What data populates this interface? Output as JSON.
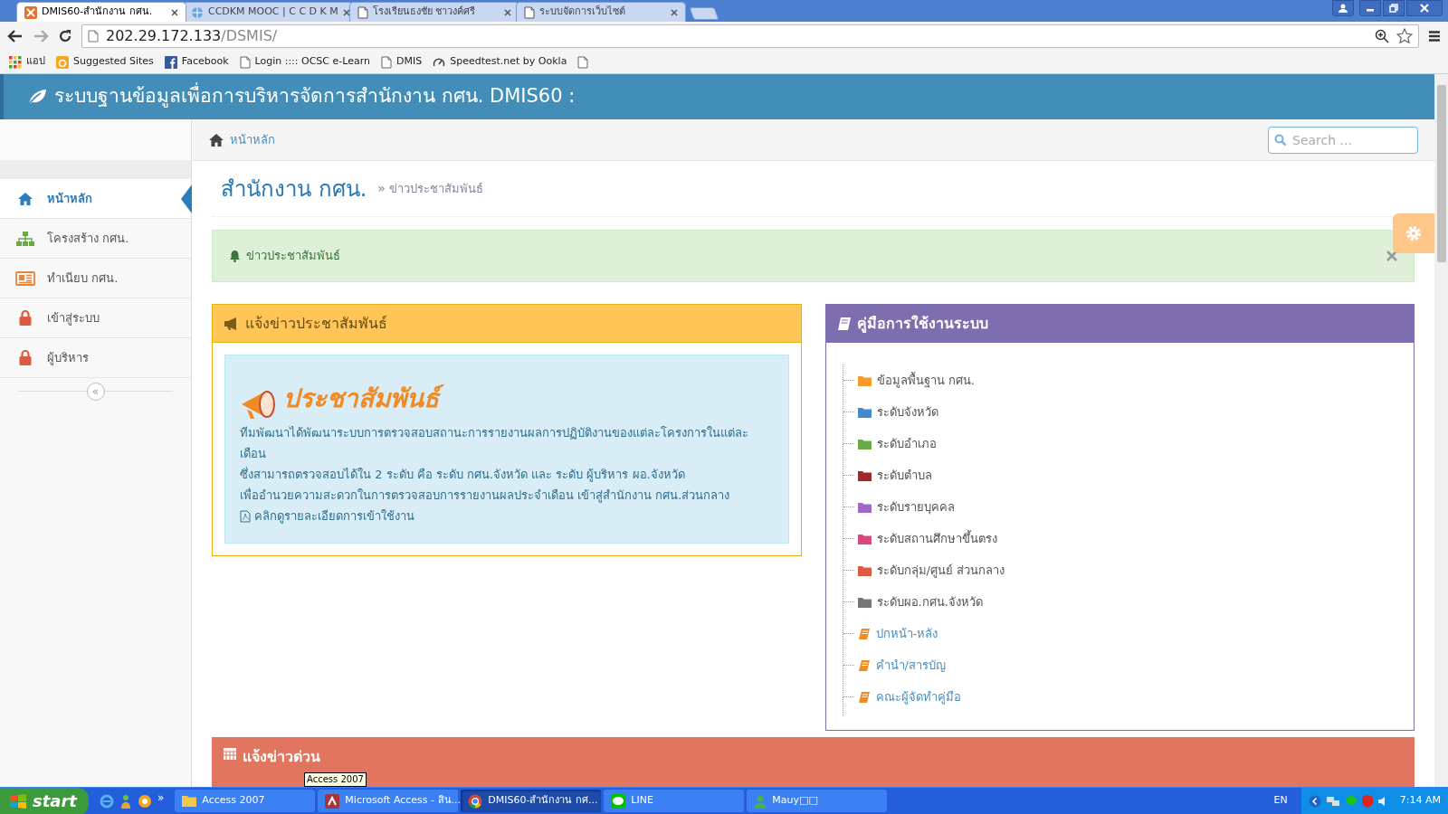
{
  "browser": {
    "tabs": [
      {
        "title": "DMIS60-สำนักงาน กศน.",
        "kind": "dmis",
        "selected": true
      },
      {
        "title": "CCDKM MOOC | C C D K M",
        "kind": "globe",
        "selected": false
      },
      {
        "title": "โรงเรียนธงชัย ชาวงค์ศรี",
        "kind": "page",
        "selected": false
      },
      {
        "title": "ระบบจัดการเว็บไซต์",
        "kind": "page",
        "selected": false
      }
    ],
    "address": {
      "host": "202.29.172.133",
      "path": "/DSMIS/"
    },
    "bookmarks": [
      {
        "label": "แอป",
        "kind": "apps"
      },
      {
        "label": "Suggested Sites",
        "kind": "suggested"
      },
      {
        "label": "Facebook",
        "kind": "facebook"
      },
      {
        "label": "Login :::: OCSC e-Learn",
        "kind": "page"
      },
      {
        "label": "DMIS",
        "kind": "page"
      },
      {
        "label": "Speedtest.net by Ookla",
        "kind": "speedtest"
      },
      {
        "kind": "page"
      }
    ]
  },
  "page": {
    "header_title": "ระบบฐานข้อมูลเพื่อการบริหารจัดการสำนักงาน กศน. DMIS60 :",
    "breadcrumb": "หน้าหลัก",
    "search": {
      "placeholder": "Search ..."
    },
    "sidebar": {
      "items": [
        {
          "label": "หน้าหลัก",
          "kind": "home",
          "selected": true
        },
        {
          "label": "โครงสร้าง กศน.",
          "kind": "sitemap",
          "selected": false
        },
        {
          "label": "ทำเนียบ กศน.",
          "kind": "newspaper",
          "selected": false
        },
        {
          "label": "เข้าสู่ระบบ",
          "kind": "lock",
          "selected": false
        },
        {
          "label": "ผู้บริหาร",
          "kind": "lock",
          "selected": false
        }
      ],
      "collapse": "«"
    },
    "title": "สำนักงาน กศน.",
    "separator": "»",
    "subtitle": "ข่าวประชาสัมพันธ์",
    "alert": "ข่าวประชาสัมพันธ์",
    "news_panel": {
      "title": "แจ้งข่าวประชาสัมพันธ์",
      "banner": "ประชาสัมพันธ์",
      "lines": [
        "ทีมพัฒนาได้พัฒนาระบบการตรวจสอบสถานะการรายงานผลการปฏิบัติงานของแต่ละโครงการในแต่ละเดือน",
        "ซึ่งสามารถตรวจสอบได้ใน 2 ระดับ คือ ระดับ กศน.จังหวัด และ ระดับ ผู้บริหาร ผอ.จังหวัด",
        "เพื่ออำนวยความสะดวกในการตรวจสอบการรายงานผลประจำเดือน เข้าสู่สำนักงาน กศน.ส่วนกลาง"
      ],
      "link": "คลิกดูรายละเอียดการเข้าใช้งาน"
    },
    "manual_panel": {
      "title": "คู่มือการใช้งานระบบ",
      "items": [
        {
          "label": "ข้อมูลพื้นฐาน กศน.",
          "kind": "folder",
          "color": "#f89b2c"
        },
        {
          "label": "ระดับจังหวัด",
          "kind": "folder",
          "color": "#428bca"
        },
        {
          "label": "ระดับอำเภอ",
          "kind": "folder",
          "color": "#69aa46"
        },
        {
          "label": "ระดับตำบล",
          "kind": "folder",
          "color": "#a0282a"
        },
        {
          "label": "ระดับรายบุคคล",
          "kind": "folder",
          "color": "#a069c3"
        },
        {
          "label": "ระดับสถานศึกษาขึ้นตรง",
          "kind": "folder",
          "color": "#d6487e"
        },
        {
          "label": "ระดับกลุ่ม/ศูนย์ ส่วนกลาง",
          "kind": "folder",
          "color": "#dd5a43"
        },
        {
          "label": "ระดับผอ.กศน.จังหวัด",
          "kind": "folder",
          "color": "#777777"
        },
        {
          "label": "ปกหน้า-หลัง",
          "kind": "book"
        },
        {
          "label": "คำนำ/สารบัญ",
          "kind": "book"
        },
        {
          "label": "คณะผู้จัดทำคู่มือ",
          "kind": "book"
        }
      ]
    },
    "urgent_panel": {
      "title": "แจ้งข่าวด่วน"
    }
  },
  "taskbar": {
    "start": "start",
    "more": "»",
    "tasks": [
      {
        "label": "Access 2007",
        "kind": "folder",
        "selected": false
      },
      {
        "label": "Microsoft Access - สิน...",
        "kind": "access",
        "selected": false
      },
      {
        "label": "DMIS60-สำนักงาน กศ...",
        "kind": "chrome",
        "selected": true
      },
      {
        "label": "LINE",
        "kind": "line",
        "selected": false
      },
      {
        "label": "Mauy□□",
        "kind": "user",
        "selected": false
      }
    ],
    "tooltip": "Access 2007",
    "language": "EN",
    "time": "7:14 AM"
  }
}
